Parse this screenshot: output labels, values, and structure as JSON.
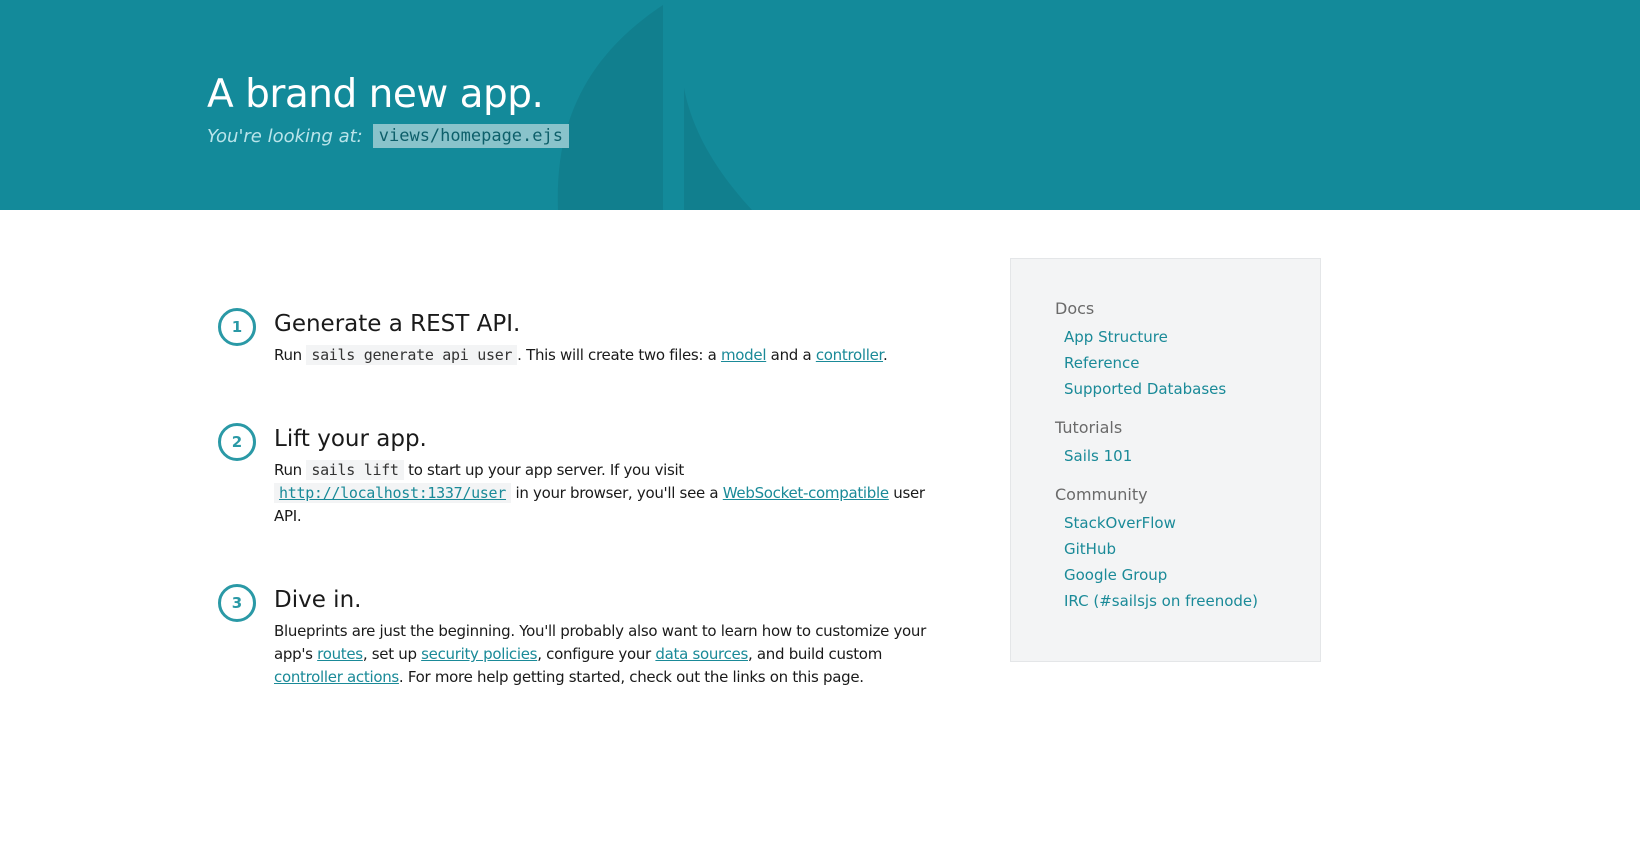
{
  "hero": {
    "title": "A brand new app.",
    "subtitle": "You're looking at:",
    "file": "views/homepage.ejs"
  },
  "steps": [
    {
      "num": "1",
      "title": "Generate a REST API.",
      "run": "Run",
      "code": "sails generate api user",
      "text1": ". This will create two files: a ",
      "link1": "model",
      "text2": " and a ",
      "link2": "controller",
      "text3": "."
    },
    {
      "num": "2",
      "title": "Lift your app.",
      "run": "Run",
      "code": "sails lift",
      "text1": " to start up your app server. If you visit",
      "url": "http://localhost:1337/user",
      "text2": " in your browser, you'll see a ",
      "link1": "WebSocket-compatible",
      "text3": " user API."
    },
    {
      "num": "3",
      "title": "Dive in.",
      "text1": "Blueprints are just the beginning. You'll probably also want to learn how to customize your app's ",
      "link1": "routes",
      "text2": ", set up ",
      "link2": "security policies",
      "text3": ", configure your ",
      "link3": "data sources",
      "text4": ", and build custom ",
      "link4": "controller actions",
      "text5": ". For more help getting started, check out the links on this page."
    }
  ],
  "sidebar": {
    "sections": [
      {
        "title": "Docs",
        "links": [
          "App Structure",
          "Reference",
          "Supported Databases"
        ]
      },
      {
        "title": "Tutorials",
        "links": [
          "Sails 101"
        ]
      },
      {
        "title": "Community",
        "links": [
          "StackOverFlow",
          "GitHub",
          "Google Group",
          "IRC (#sailsjs on freenode)"
        ]
      }
    ]
  },
  "colors": {
    "header": "#138a9a",
    "accent": "#1a8a98",
    "sidebar_bg": "#f3f4f5"
  }
}
